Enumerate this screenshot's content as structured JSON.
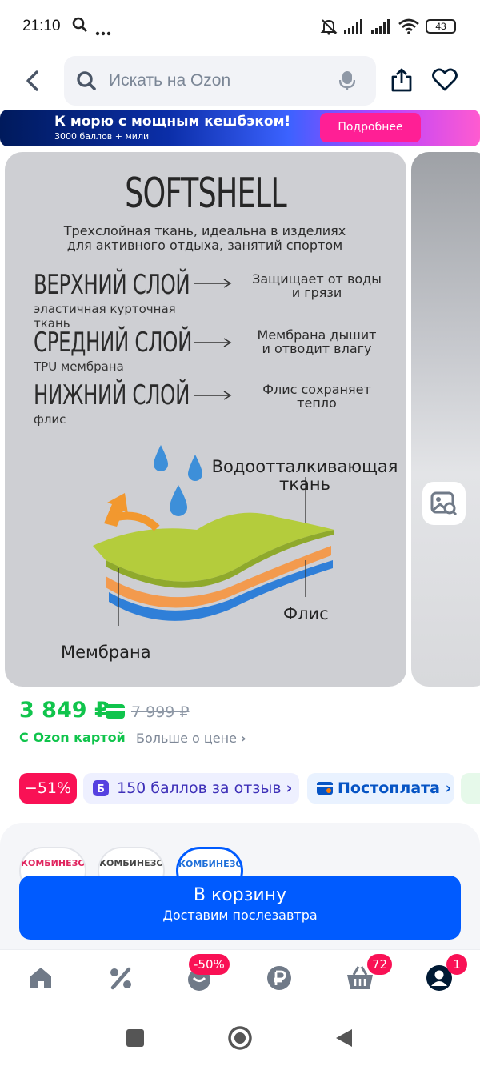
{
  "status_bar": {
    "time": "21:10",
    "battery": "43"
  },
  "header": {
    "search_placeholder": "Искать на Ozon"
  },
  "promo": {
    "title": "К морю с мощным кешбэком!",
    "subtitle": "3000 баллов + мили",
    "button": "Подробнее"
  },
  "product_image": {
    "title": "SOFTSHELL",
    "subtitle_line1": "Трехслойная ткань, идеальна в изделиях",
    "subtitle_line2": "для активного отдыха, занятий спортом",
    "layers": [
      {
        "name": "ВЕРХНИЙ СЛОЙ",
        "desc_line1": "эластичная курточная",
        "desc_line2": "ткань",
        "effect_line1": "Защищает от воды",
        "effect_line2": "и грязи"
      },
      {
        "name": "СРЕДНИЙ СЛОЙ",
        "desc_line1": "TPU мембрана",
        "desc_line2": "",
        "effect_line1": "Мембрана дышит",
        "effect_line2": "и отводит влагу"
      },
      {
        "name": "НИЖНИЙ СЛОЙ",
        "desc_line1": "флис",
        "desc_line2": "",
        "effect_line1": "Флис сохраняет",
        "effect_line2": "тепло"
      }
    ],
    "label_water_line1": "Водоотталкивающая",
    "label_water_line2": "ткань",
    "label_fleece": "Флис",
    "label_membrane": "Мембрана"
  },
  "price": {
    "current": "3 849 ₽",
    "old": "7 999 ₽",
    "ozon_card": "С Ozon картой",
    "more": "Больше о цене"
  },
  "badges": {
    "discount": "−51%",
    "bonus": "150 баллов за отзыв",
    "postpay": "Постоплата"
  },
  "variants": [
    {
      "label": "КОМБИНЕЗОН",
      "color": "#e0245e",
      "selected": false
    },
    {
      "label": "КОМБИНЕЗОН",
      "color": "#444444",
      "selected": false
    },
    {
      "label": "КОМБИНЕЗОН",
      "color": "#1e6fd9",
      "selected": true
    }
  ],
  "cart_button": {
    "title": "В корзину",
    "subtitle": "Доставим послезавтра"
  },
  "bottom_nav": {
    "fresh_badge": "-50%",
    "cart_badge": "72",
    "profile_badge": "1"
  },
  "colors": {
    "accent": "#005bff",
    "price_green": "#10c44c",
    "discount_red": "#f91155"
  }
}
